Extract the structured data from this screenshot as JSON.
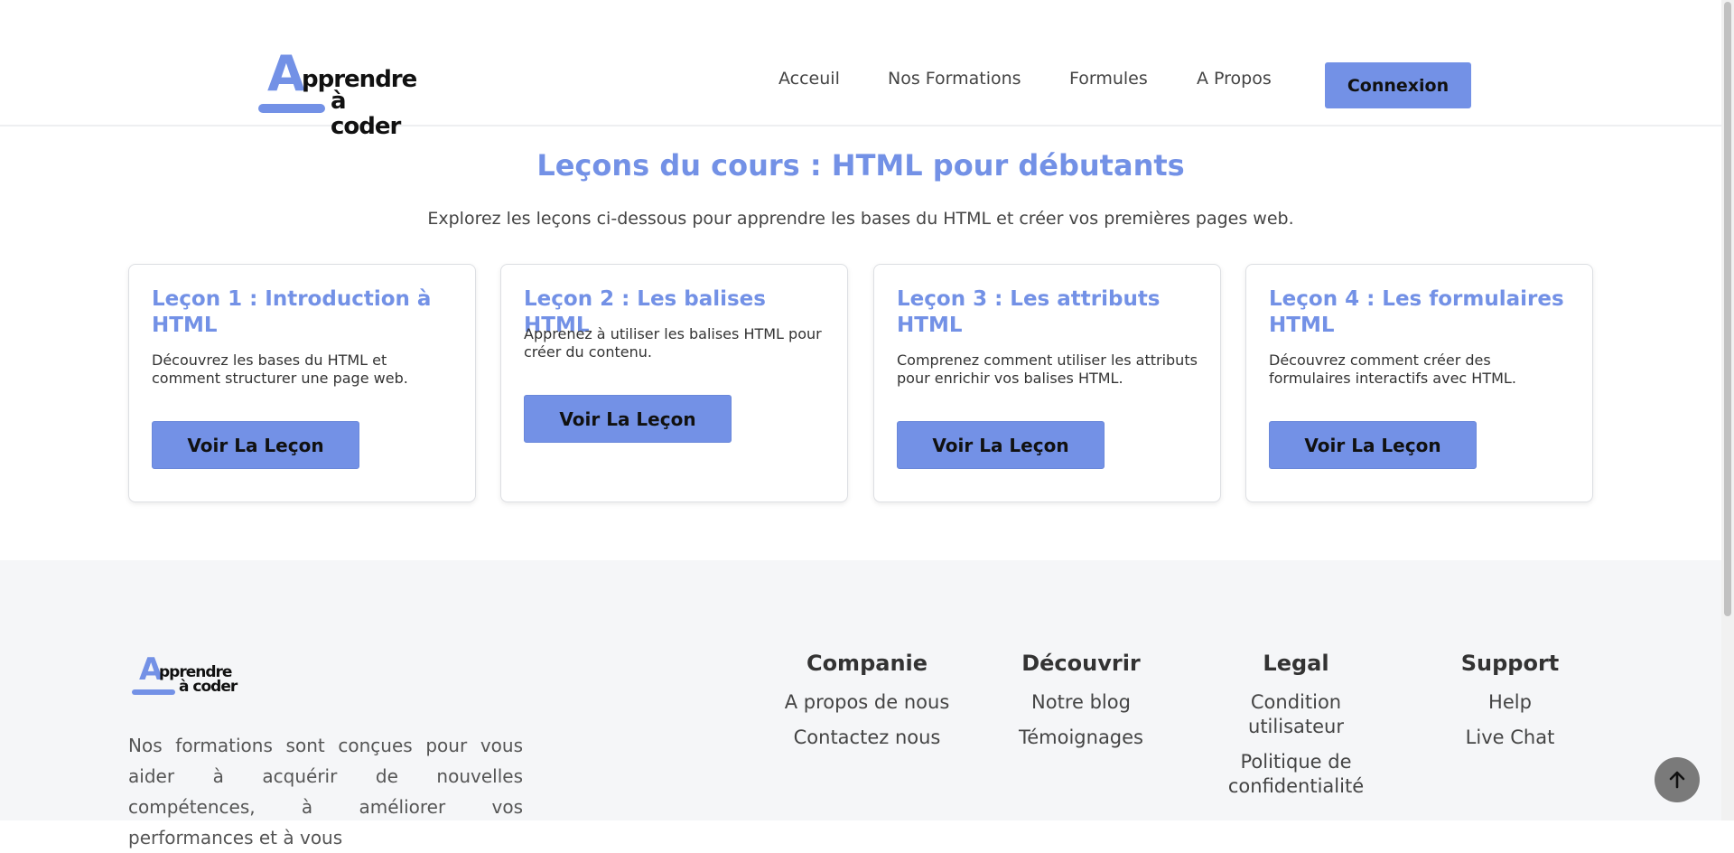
{
  "header": {
    "logo": {
      "big_letter": "A",
      "line1": "pprendre",
      "line2": "à coder"
    },
    "nav": [
      "Acceuil",
      "Nos Formations",
      "Formules",
      "A Propos"
    ],
    "login_label": "Connexion"
  },
  "hero": {
    "title": "Leçons du cours : HTML pour débutants",
    "subtitle": "Explorez les leçons ci-dessous pour apprendre les bases du HTML et créer vos premières pages web."
  },
  "lessons": [
    {
      "title": "Leçon 1 : Introduction à HTML",
      "text": "Découvrez les bases du HTML et comment structurer une page web.",
      "button": "Voir La Leçon"
    },
    {
      "title": "Leçon 2 : Les balises HTML",
      "text": "Apprenez à utiliser les balises HTML pour créer du contenu.",
      "button": "Voir La Leçon"
    },
    {
      "title": "Leçon 3 : Les attributs HTML",
      "text": "Comprenez comment utiliser les attributs pour enrichir vos balises HTML.",
      "button": "Voir La Leçon"
    },
    {
      "title": "Leçon 4 : Les formulaires HTML",
      "text": "Découvrez comment créer des formulaires interactifs avec HTML.",
      "button": "Voir La Leçon"
    }
  ],
  "footer": {
    "logo": {
      "big_letter": "A",
      "line1": "pprendre",
      "line2": "à coder"
    },
    "description": "Nos formations sont conçues pour vous aider à acquérir de nouvelles compétences, à améliorer vos performances et à vous",
    "columns": [
      {
        "title": "Companie",
        "links": [
          "A propos de nous",
          "Contactez nous"
        ]
      },
      {
        "title": "Découvrir",
        "links": [
          "Notre blog",
          "Témoignages"
        ]
      },
      {
        "title": "Legal",
        "links": [
          "Condition utilisateur",
          "Politique de confidentialité"
        ]
      },
      {
        "title": "Support",
        "links": [
          "Help",
          "Live Chat"
        ]
      }
    ]
  },
  "scroll_top_icon": "arrow-up-icon",
  "colors": {
    "accent": "#7391e6",
    "footer_bg": "#f5f6f8"
  }
}
